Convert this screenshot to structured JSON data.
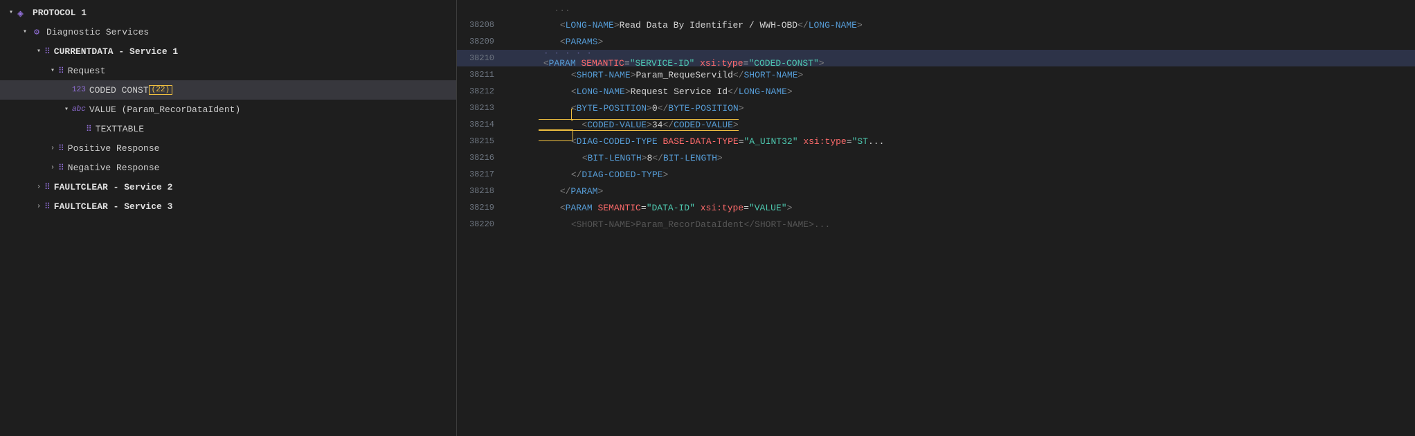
{
  "leftPanel": {
    "items": [
      {
        "id": "protocol1",
        "indent": 0,
        "icon": "layers",
        "label": "PROTOCOL 1",
        "chevron": "down",
        "bold": true
      },
      {
        "id": "diagnostic",
        "indent": 1,
        "icon": "gear",
        "label": "Diagnostic Services",
        "chevron": "down",
        "bold": false
      },
      {
        "id": "currentdata",
        "indent": 2,
        "icon": "grid",
        "label": "CURRENTDATA - Service 1",
        "chevron": "down",
        "bold": true
      },
      {
        "id": "request",
        "indent": 3,
        "icon": "grid",
        "label": "Request",
        "chevron": "down",
        "bold": false
      },
      {
        "id": "coded_const",
        "indent": 4,
        "icon": "123",
        "label": "CODED CONST",
        "badge": "(22)",
        "chevron": null,
        "bold": false,
        "selected": true
      },
      {
        "id": "value_param",
        "indent": 4,
        "icon": "abc",
        "label": "VALUE (Param_RecorDataIdent)",
        "chevron": "down",
        "bold": false
      },
      {
        "id": "texttable",
        "indent": 5,
        "icon": "grid",
        "label": "TEXTTABLE",
        "chevron": null,
        "bold": false
      },
      {
        "id": "positive_response",
        "indent": 3,
        "icon": "grid",
        "label": "Positive Response",
        "chevron": "right",
        "bold": false
      },
      {
        "id": "negative_response",
        "indent": 3,
        "icon": "grid",
        "label": "Negative Response",
        "chevron": "right",
        "bold": false
      },
      {
        "id": "faultclear2",
        "indent": 2,
        "icon": "grid",
        "label": "FAULTCLEAR - Service 2",
        "chevron": "right",
        "bold": true
      },
      {
        "id": "faultclear3",
        "indent": 2,
        "icon": "grid",
        "label": "FAULTCLEAR - Service 3",
        "chevron": "right",
        "bold": true
      }
    ]
  },
  "rightPanel": {
    "lines": [
      {
        "num": "",
        "indent": 0,
        "highlighted": false,
        "parts": [
          {
            "type": "faded",
            "text": "..."
          }
        ]
      },
      {
        "num": "38208",
        "indent": 2,
        "highlighted": false,
        "parts": [
          {
            "type": "bracket",
            "text": "<"
          },
          {
            "type": "tag",
            "text": "LONG-NAME"
          },
          {
            "type": "bracket",
            "text": ">"
          },
          {
            "type": "text",
            "text": "Read Data By Identifier / WWH-OBD"
          },
          {
            "type": "bracket",
            "text": "</"
          },
          {
            "type": "tag",
            "text": "LONG-NAME"
          },
          {
            "type": "bracket",
            "text": ">"
          }
        ]
      },
      {
        "num": "38209",
        "indent": 2,
        "highlighted": false,
        "parts": [
          {
            "type": "bracket",
            "text": "<"
          },
          {
            "type": "tag",
            "text": "PARAMS"
          },
          {
            "type": "bracket",
            "text": ">"
          }
        ]
      },
      {
        "num": "38210",
        "indent": 3,
        "highlighted": true,
        "dotted": true,
        "parts": [
          {
            "type": "bracket",
            "text": "<"
          },
          {
            "type": "tag",
            "text": "PARAM"
          },
          {
            "type": "text",
            "text": " "
          },
          {
            "type": "attr",
            "text": "SEMANTIC"
          },
          {
            "type": "text",
            "text": "="
          },
          {
            "type": "attr-val",
            "text": "\"SERVICE-ID\""
          },
          {
            "type": "text",
            "text": " "
          },
          {
            "type": "attr",
            "text": "xsi:type"
          },
          {
            "type": "text",
            "text": "="
          },
          {
            "type": "attr-val",
            "text": "\"CODED-CONST\""
          },
          {
            "type": "bracket",
            "text": ">"
          }
        ]
      },
      {
        "num": "38211",
        "indent": 4,
        "highlighted": false,
        "parts": [
          {
            "type": "bracket",
            "text": "<"
          },
          {
            "type": "tag",
            "text": "SHORT-NAME"
          },
          {
            "type": "bracket",
            "text": ">"
          },
          {
            "type": "text",
            "text": "Param_RequeServild"
          },
          {
            "type": "bracket",
            "text": "</"
          },
          {
            "type": "tag",
            "text": "SHORT-NAME"
          },
          {
            "type": "bracket",
            "text": ">"
          }
        ]
      },
      {
        "num": "38212",
        "indent": 4,
        "highlighted": false,
        "parts": [
          {
            "type": "bracket",
            "text": "<"
          },
          {
            "type": "tag",
            "text": "LONG-NAME"
          },
          {
            "type": "bracket",
            "text": ">"
          },
          {
            "type": "text",
            "text": "Request Service Id"
          },
          {
            "type": "bracket",
            "text": "</"
          },
          {
            "type": "tag",
            "text": "LONG-NAME"
          },
          {
            "type": "bracket",
            "text": ">"
          }
        ]
      },
      {
        "num": "38213",
        "indent": 4,
        "highlighted": false,
        "parts": [
          {
            "type": "bracket",
            "text": "<"
          },
          {
            "type": "tag",
            "text": "BYTE-POSITION"
          },
          {
            "type": "bracket",
            "text": ">"
          },
          {
            "type": "text",
            "text": "0"
          },
          {
            "type": "bracket",
            "text": "</"
          },
          {
            "type": "tag",
            "text": "BYTE-POSITION"
          },
          {
            "type": "bracket",
            "text": ">"
          }
        ]
      },
      {
        "num": "38214",
        "indent": 4,
        "highlighted": false,
        "yellow": true,
        "parts": [
          {
            "type": "bracket",
            "text": "<"
          },
          {
            "type": "tag",
            "text": "CODED-VALUE"
          },
          {
            "type": "bracket",
            "text": ">"
          },
          {
            "type": "text",
            "text": "34"
          },
          {
            "type": "bracket",
            "text": "</"
          },
          {
            "type": "tag",
            "text": "CODED-VALUE"
          },
          {
            "type": "bracket",
            "text": ">"
          }
        ]
      },
      {
        "num": "38215",
        "indent": 4,
        "highlighted": false,
        "parts": [
          {
            "type": "bracket",
            "text": "<"
          },
          {
            "type": "tag",
            "text": "DIAG-CODED-TYPE"
          },
          {
            "type": "text",
            "text": " "
          },
          {
            "type": "attr",
            "text": "BASE-DATA-TYPE"
          },
          {
            "type": "text",
            "text": "="
          },
          {
            "type": "attr-val",
            "text": "\"A_UINT32\""
          },
          {
            "type": "text",
            "text": " "
          },
          {
            "type": "attr",
            "text": "xsi:type"
          },
          {
            "type": "text",
            "text": "="
          },
          {
            "type": "attr-val",
            "text": "\"ST"
          },
          {
            "type": "text",
            "text": "..."
          }
        ]
      },
      {
        "num": "38216",
        "indent": 5,
        "highlighted": false,
        "parts": [
          {
            "type": "bracket",
            "text": "<"
          },
          {
            "type": "tag",
            "text": "BIT-LENGTH"
          },
          {
            "type": "bracket",
            "text": ">"
          },
          {
            "type": "text",
            "text": "8"
          },
          {
            "type": "bracket",
            "text": "</"
          },
          {
            "type": "tag",
            "text": "BIT-LENGTH"
          },
          {
            "type": "bracket",
            "text": ">"
          }
        ]
      },
      {
        "num": "38217",
        "indent": 4,
        "highlighted": false,
        "parts": [
          {
            "type": "bracket",
            "text": "</"
          },
          {
            "type": "tag",
            "text": "DIAG-CODED-TYPE"
          },
          {
            "type": "bracket",
            "text": ">"
          }
        ]
      },
      {
        "num": "38218",
        "indent": 3,
        "highlighted": false,
        "parts": [
          {
            "type": "bracket",
            "text": "</"
          },
          {
            "type": "tag",
            "text": "PARAM"
          },
          {
            "type": "bracket",
            "text": ">"
          }
        ]
      },
      {
        "num": "38219",
        "indent": 3,
        "highlighted": false,
        "parts": [
          {
            "type": "bracket",
            "text": "<"
          },
          {
            "type": "tag",
            "text": "PARAM"
          },
          {
            "type": "text",
            "text": " "
          },
          {
            "type": "attr",
            "text": "SEMANTIC"
          },
          {
            "type": "text",
            "text": "="
          },
          {
            "type": "attr-val",
            "text": "\"DATA-ID\""
          },
          {
            "type": "text",
            "text": " "
          },
          {
            "type": "attr",
            "text": "xsi:type"
          },
          {
            "type": "text",
            "text": "="
          },
          {
            "type": "attr-val",
            "text": "\"VALUE\""
          },
          {
            "type": "bracket",
            "text": ">"
          }
        ]
      },
      {
        "num": "38220",
        "indent": 4,
        "highlighted": false,
        "parts": [
          {
            "type": "faded",
            "text": "    <SHORT-NAME>Param_RecorDataIdent</SHORT-NAME>..."
          }
        ]
      }
    ]
  }
}
